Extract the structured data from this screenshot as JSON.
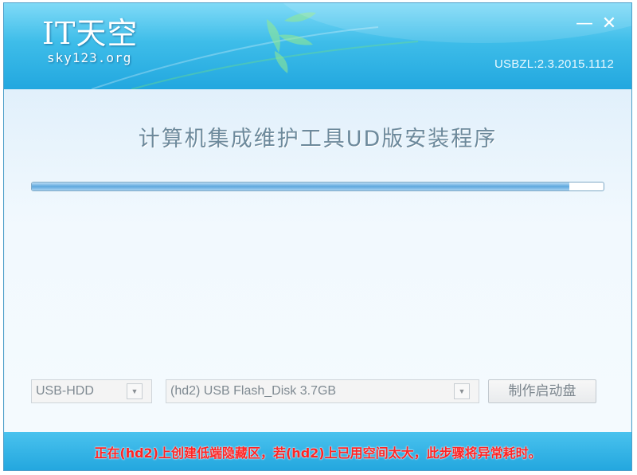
{
  "titlebar": {
    "logo_main": "IT天空",
    "logo_sub": "sky123.org",
    "minimize_label": "—",
    "close_label": "✕",
    "version": "USBZL:2.3.2015.1112"
  },
  "main": {
    "title": "计算机集成维护工具UD版安装程序",
    "progress": 0.94
  },
  "controls": {
    "mode_value": "USB-HDD",
    "disk_value": "(hd2) USB Flash_Disk 3.7GB",
    "dropdown_arrow": "▼",
    "make_button_label": "制作启动盘"
  },
  "status": {
    "message": "正在(hd2)上创建低端隐藏区，若(hd2)上已用空间太大，此步骤将异常耗时。"
  },
  "colors": {
    "titlebar": "#2bb0e3",
    "status_text": "#ff2424",
    "progress_fill": "#5ea8de"
  }
}
